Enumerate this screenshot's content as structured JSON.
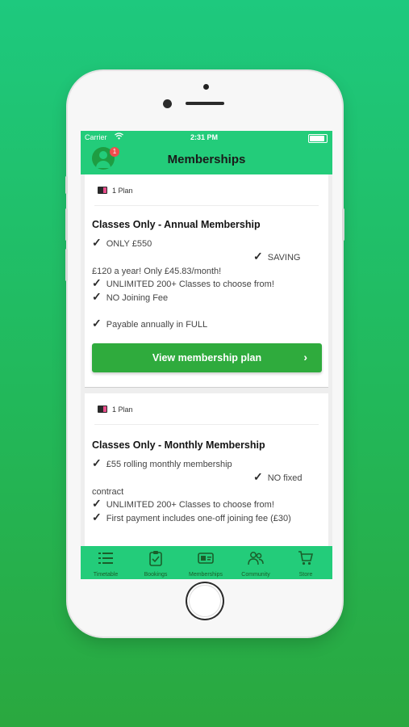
{
  "status_bar": {
    "carrier": "Carrier",
    "time": "2:31 PM"
  },
  "header": {
    "title": "Memberships",
    "notification_count": "1"
  },
  "cards": [
    {
      "plan_count": "1 Plan",
      "title": "Classes Only - Annual Membership",
      "lines": [
        "ONLY £550",
        "SAVING",
        "£120 a year! Only £45.83/month!",
        "UNLIMITED 200+ Classes to choose from!",
        "NO Joining Fee",
        "Payable annually in FULL"
      ],
      "button_label": "View membership plan"
    },
    {
      "plan_count": "1 Plan",
      "title": "Classes Only - Monthly Membership",
      "lines": [
        "£55 rolling monthly membership",
        "NO fixed",
        "contract",
        "UNLIMITED 200+ Classes to choose from!",
        "First payment includes one-off joining fee (£30)"
      ]
    }
  ],
  "tabbar": {
    "items": [
      {
        "label": "Timetable",
        "icon": "list-icon"
      },
      {
        "label": "Bookings",
        "icon": "clipboard-check-icon"
      },
      {
        "label": "Memberships",
        "icon": "membership-card-icon"
      },
      {
        "label": "Community",
        "icon": "people-icon"
      },
      {
        "label": "Store",
        "icon": "cart-icon"
      }
    ]
  },
  "colors": {
    "brand": "#23cc7a",
    "button": "#2fab3d",
    "badge": "#f04d4d"
  }
}
